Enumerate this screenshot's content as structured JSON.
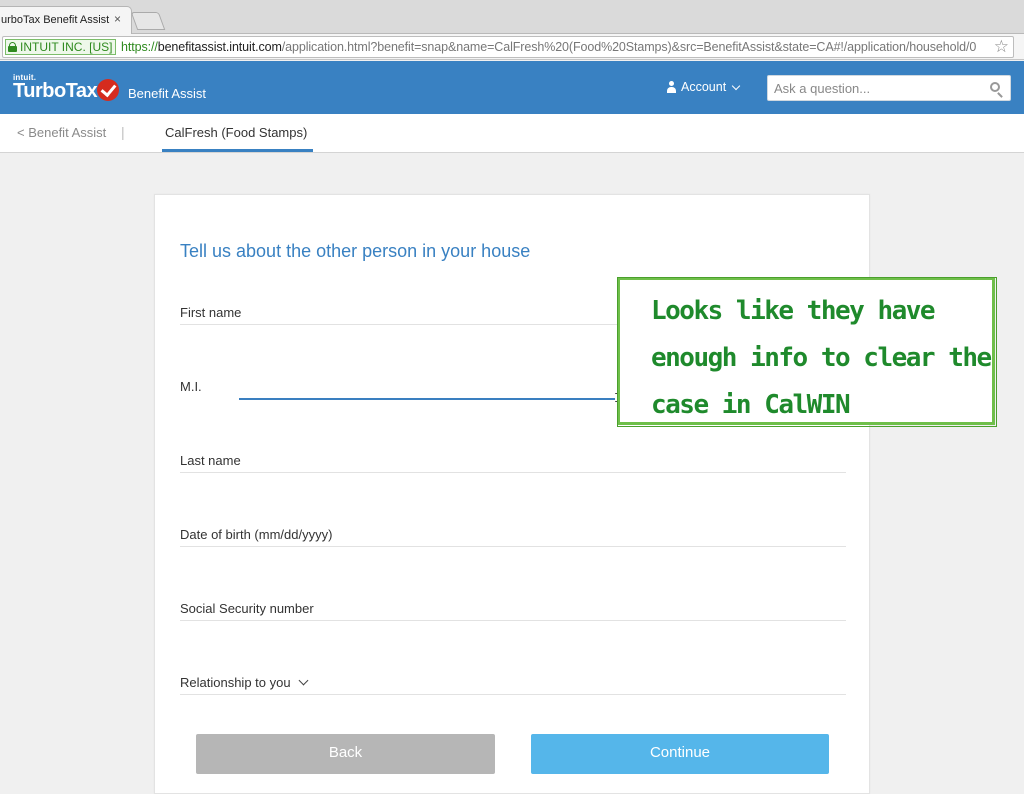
{
  "browser": {
    "tab_title": "urboTax Benefit Assist",
    "tab_close": "×",
    "ev_label": "INTUIT INC. [US]",
    "url_scheme": "https://",
    "url_host": "benefitassist.intuit.com",
    "url_path": "/application.html?benefit=snap&name=CalFresh%20(Food%20Stamps)&src=BenefitAssist&state=CA#!/application/household/0",
    "star": "☆"
  },
  "header": {
    "logo_intuit": "intuit.",
    "logo_brand": "TurboTax",
    "logo_product": "Benefit Assist",
    "account_label": "Account",
    "search_placeholder": "Ask a question..."
  },
  "subnav": {
    "back_label": "< Benefit Assist",
    "separator": "|",
    "active_tab": "CalFresh (Food Stamps)"
  },
  "form": {
    "title": "Tell us about the other person in your house",
    "fields": [
      {
        "label": "First name"
      },
      {
        "label": "M.I."
      },
      {
        "label": "Last name"
      },
      {
        "label": "Date of birth (mm/dd/yyyy)"
      },
      {
        "label": "Social Security number"
      },
      {
        "label": "Relationship to you"
      }
    ],
    "back_button": "Back",
    "continue_button": "Continue"
  },
  "annotation": {
    "text": "Looks like they have enough info to clear the case in CalWIN"
  },
  "colors": {
    "brand_blue": "#3981c2",
    "continue_blue": "#55b6ea",
    "annotation_green": "#1f8a2c"
  }
}
